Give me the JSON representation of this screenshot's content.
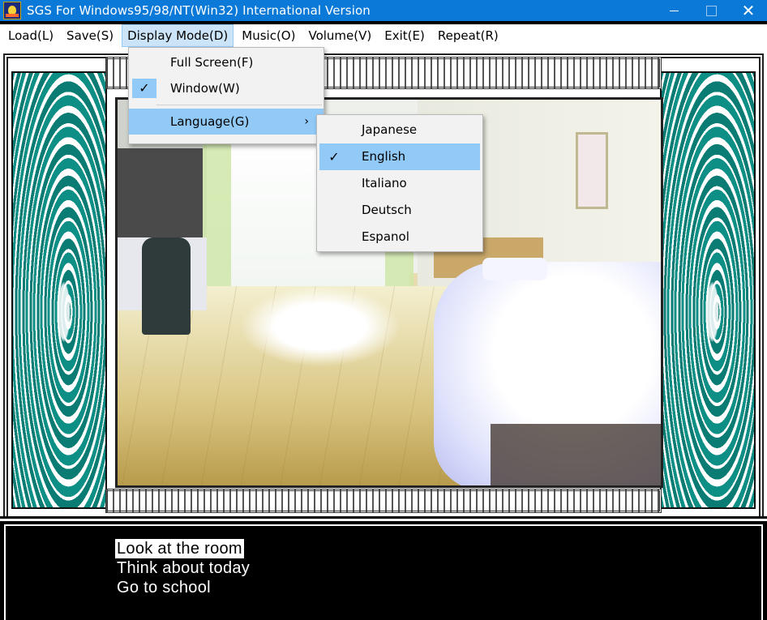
{
  "window": {
    "title": "SGS For Windows95/98/NT(Win32) International Version",
    "icon": "app-icon",
    "controls": [
      "minimize",
      "maximize",
      "close"
    ],
    "close_glyph": "✕"
  },
  "menubar": {
    "items": [
      {
        "label": "Load(L)"
      },
      {
        "label": "Save(S)"
      },
      {
        "label": "Display Mode(D)",
        "active": true
      },
      {
        "label": "Music(O)"
      },
      {
        "label": "Volume(V)"
      },
      {
        "label": "Exit(E)"
      },
      {
        "label": "Repeat(R)"
      }
    ]
  },
  "display_menu": {
    "items": [
      {
        "label": "Full Screen(F)",
        "checked": false
      },
      {
        "label": "Window(W)",
        "checked": true
      },
      {
        "label": "Language(G)",
        "submenu": true,
        "arrow": "›"
      }
    ]
  },
  "language_menu": {
    "items": [
      {
        "label": "Japanese",
        "checked": false
      },
      {
        "label": "English",
        "checked": true
      },
      {
        "label": "Italiano",
        "checked": false
      },
      {
        "label": "Deutsch",
        "checked": false
      },
      {
        "label": "Espanol",
        "checked": false
      }
    ]
  },
  "check_glyph": "✓",
  "dialog": {
    "choices": [
      {
        "label": "Look at the room",
        "selected": true
      },
      {
        "label": "Think about today",
        "selected": false
      },
      {
        "label": "Go to school",
        "selected": false
      }
    ]
  },
  "colors": {
    "titlebar": "#0a79d7",
    "menu_highlight": "#91c9f7",
    "frame_teal": "#0b7c74"
  }
}
